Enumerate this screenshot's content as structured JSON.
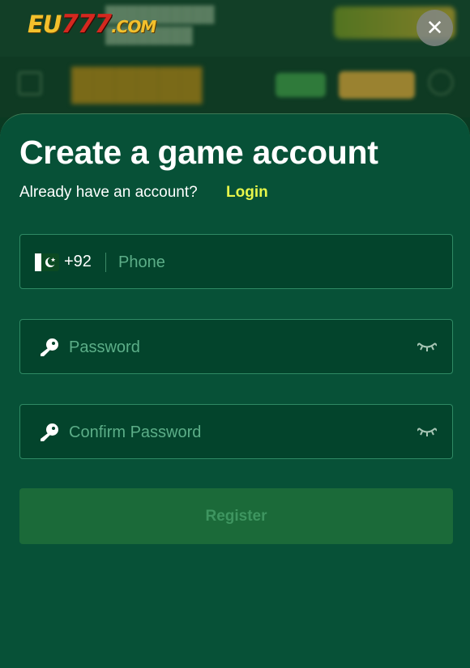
{
  "header": {
    "logo_eu": "EU",
    "logo_num": "777",
    "logo_com": ".COM",
    "close_icon": "close-icon",
    "close_glyph": "✕"
  },
  "modal": {
    "title": "Create a game account",
    "subtitle": "Already have an account?",
    "login_label": "Login",
    "phone": {
      "flag_icon": "pakistan-flag-icon",
      "country_code": "+92",
      "placeholder": "Phone",
      "value": ""
    },
    "password": {
      "icon": "key-icon",
      "placeholder": "Password",
      "value": "",
      "toggle_icon": "eye-closed-icon"
    },
    "confirm_password": {
      "icon": "key-icon",
      "placeholder": "Confirm Password",
      "value": "",
      "toggle_icon": "eye-closed-icon"
    },
    "register_label": "Register"
  },
  "colors": {
    "panel_bg": "#075137",
    "field_bg": "#03442c",
    "field_border": "#2f8a64",
    "accent_link": "#e6f54a",
    "register_bg": "#1b6a39"
  }
}
